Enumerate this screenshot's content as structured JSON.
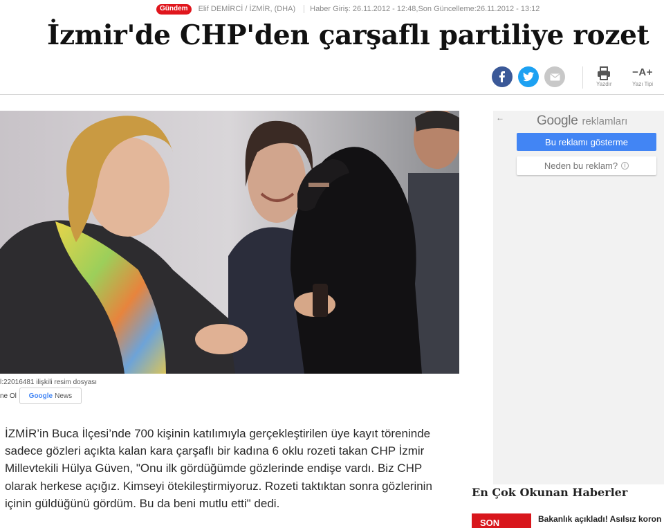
{
  "meta": {
    "category": "Gündem",
    "author": "Elif DEMİRCİ / İZMİR, (DHA)",
    "published": "Haber Giriş: 26.11.2012 - 12:48,Son Güncelleme:26.11.2012 - 13:12"
  },
  "article": {
    "title": "İzmir'de CHP'den çarşaflı partiliye rozet",
    "photo_caption": "l:22016481 ilişkili resim dosyası",
    "follow_label": "ne Ol",
    "google_news": {
      "g": "Google",
      "n": "News"
    },
    "body": "İZMİR’in Buca İlçesi’nde 700 kişinin katılımıyla gerçekleştirilen üye kayıt töreninde sadece gözleri açıkta kalan kara çarşaflı bir kadına 6 oklu rozeti takan CHP İzmir Millevtekili Hülya Güven, \"Onu ilk gördüğümde gözlerinde endişe vardı. Biz CHP olarak herkese açığız. Kimseyi ötekileştirmiyoruz. Rozeti taktıktan sonra gözlerinin içinin güldüğünü gördüm. Bu da beni mutlu etti\" dedi."
  },
  "tools": {
    "print_label": "Yazdır",
    "fontsize_glyph": "−A+",
    "fontsize_label": "Yazı Tipi"
  },
  "ad": {
    "back": "←",
    "google": "Google",
    "reklamlari": "reklamları",
    "hide_button": "Bu reklamı gösterme",
    "why_button": "Neden bu reklam?",
    "info": "i"
  },
  "most_read": {
    "title": "En Çok Okunan Haberler",
    "items": [
      {
        "badge": "SON",
        "headline": "Bakanlık açıkladı! Asılsız koron"
      }
    ]
  },
  "colors": {
    "category_red": "#e0161d",
    "facebook": "#3b5998",
    "twitter": "#1da1f2",
    "google_blue": "#4285f4"
  },
  "icons": [
    "facebook-icon",
    "twitter-icon",
    "mail-icon",
    "print-icon",
    "info-icon",
    "back-arrow-icon"
  ]
}
